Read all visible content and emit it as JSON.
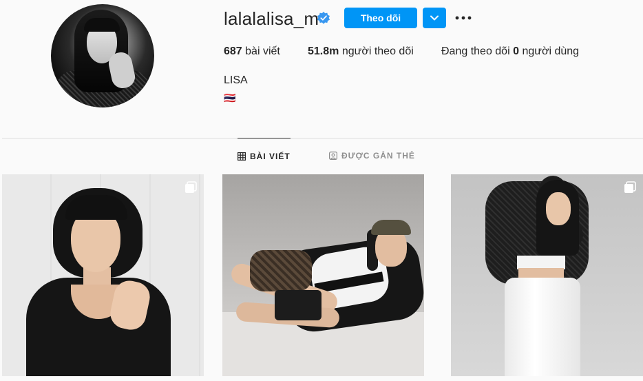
{
  "profile": {
    "username": "lalalalisa_m",
    "verified": true,
    "follow_label": "Theo dõi",
    "full_name": "LISA",
    "bio": "🇹🇭",
    "stats": {
      "posts_count": "687",
      "posts_label": "bài viết",
      "followers_count": "51.8m",
      "followers_label": "người theo dõi",
      "following_prefix": "Đang theo dõi",
      "following_count": "0",
      "following_label": "người dùng"
    }
  },
  "tabs": [
    {
      "label": "BÀI VIẾT",
      "icon": "grid-icon",
      "active": true
    },
    {
      "label": "ĐƯỢC GẮN THẺ",
      "icon": "tagged-icon",
      "active": false
    }
  ],
  "posts": [
    {
      "multi": true
    },
    {
      "multi": false
    },
    {
      "multi": true
    }
  ],
  "colors": {
    "accent": "#0095f6",
    "background": "#fafafa",
    "text": "#262626",
    "muted": "#8e8e8e",
    "border": "#dbdbdb"
  }
}
